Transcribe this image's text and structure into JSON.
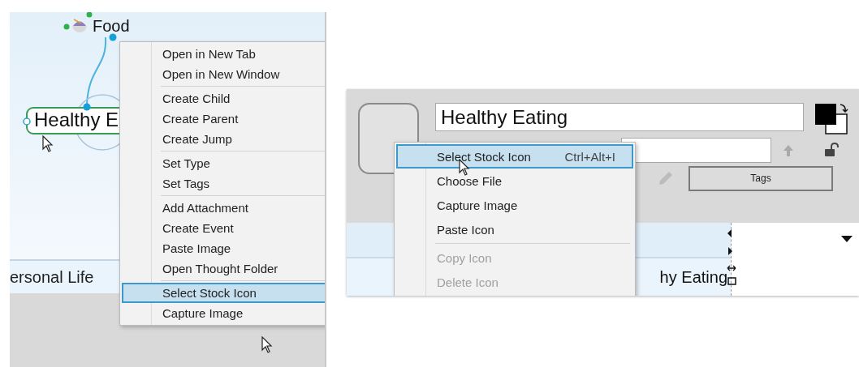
{
  "left_panel": {
    "map_nodes": [
      {
        "kind": "topic",
        "label": "Food"
      },
      {
        "kind": "selected-topic",
        "label": "Healthy E"
      }
    ],
    "bottom_label": "ersonal Life",
    "context_menu": {
      "groups": [
        {
          "items": [
            {
              "label": "Open in New Tab",
              "selected": false
            },
            {
              "label": "Open in New Window",
              "selected": false
            }
          ]
        },
        {
          "items": [
            {
              "label": "Create Child",
              "selected": false
            },
            {
              "label": "Create Parent",
              "selected": false
            },
            {
              "label": "Create Jump",
              "selected": false
            }
          ]
        },
        {
          "items": [
            {
              "label": "Set Type",
              "selected": false
            },
            {
              "label": "Set Tags",
              "selected": false
            }
          ]
        },
        {
          "items": [
            {
              "label": "Add Attachment",
              "selected": false
            },
            {
              "label": "Create Event",
              "selected": false
            },
            {
              "label": "Paste Image",
              "selected": false
            },
            {
              "label": "Open Thought Folder",
              "selected": false
            }
          ]
        },
        {
          "items": [
            {
              "label": "Select Stock Icon",
              "selected": true
            },
            {
              "label": "Capture Image",
              "selected": false
            }
          ]
        }
      ]
    }
  },
  "right_panel": {
    "title_field": {
      "value": "Healthy Eating"
    },
    "tags_button": "Tags",
    "map_label": "hy Eating",
    "context_menu": {
      "groups": [
        {
          "items": [
            {
              "label": "Select Stock Icon",
              "shortcut": "Ctrl+Alt+I",
              "selected": true,
              "disabled": false
            },
            {
              "label": "Choose File",
              "selected": false,
              "disabled": false
            },
            {
              "label": "Capture Image",
              "selected": false,
              "disabled": false
            },
            {
              "label": "Paste Icon",
              "selected": false,
              "disabled": false
            }
          ]
        },
        {
          "items": [
            {
              "label": "Copy Icon",
              "selected": false,
              "disabled": true
            },
            {
              "label": "Delete Icon",
              "selected": false,
              "disabled": true
            }
          ]
        }
      ]
    }
  }
}
